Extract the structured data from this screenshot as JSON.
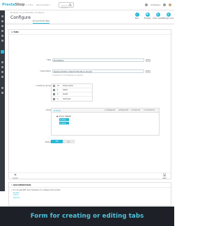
{
  "topbar": {
    "logo_main": "Presta",
    "logo_shop": "Shop",
    "version": "1.7.6.2",
    "quick_access": "Quick Access ▾",
    "search_placeholder": "Search (e.g.: product",
    "shops_label": "All shops ▾"
  },
  "header": {
    "breadcrumb": "Modules  /  ec_producttabs  /  Configure",
    "title": "Configure",
    "tab_label": "Product Extra Tabs",
    "actions": [
      {
        "label": "Back"
      },
      {
        "label": "Translate"
      },
      {
        "label": "Check update"
      },
      {
        "label": "Manage hooks"
      }
    ]
  },
  "form": {
    "heading": "⚙ TABS",
    "title_label": "Title",
    "title_value": "Promotions",
    "title_lang": "en ▾",
    "description_label": "Description",
    "description_value": "Special promotion content for this tab on and grid",
    "description_lang": "en ▾",
    "description_help": "a maximum of 70 characters is required",
    "customer_group_label": "Customer group",
    "group_header": {
      "id": "ID",
      "name": "Group name"
    },
    "groups": [
      {
        "id": "1",
        "name": "Visitor"
      },
      {
        "id": "2",
        "name": "Guest"
      },
      {
        "id": "3",
        "name": "Customer"
      }
    ],
    "shop_label": "Shop",
    "shop_tree_title": "⊞ Shops",
    "shop_buttons": {
      "collapse": "⊟ Collapse All",
      "expand": "⊞ Expand All",
      "check": "☑ Check All",
      "uncheck": "☐ Uncheck All"
    },
    "shop_group": "Group: Default",
    "shop_items": [
      "⊟ shop",
      "⊟ shop"
    ],
    "status_label": "Status",
    "status_yes": "YES",
    "status_no": "NO",
    "cancel_label": "Cancel",
    "save_label": "Save"
  },
  "documentation": {
    "heading": "✎ DOCUMENTATION",
    "text": "» You can get PDF documentation to configure this module :",
    "links": [
      "English",
      "French",
      "Spanish"
    ]
  },
  "caption": "Form for creating or editing tabs",
  "colors": {
    "accent": "#25b9d7",
    "sidebar": "#363a41",
    "caption_bg": "#1d2127"
  }
}
